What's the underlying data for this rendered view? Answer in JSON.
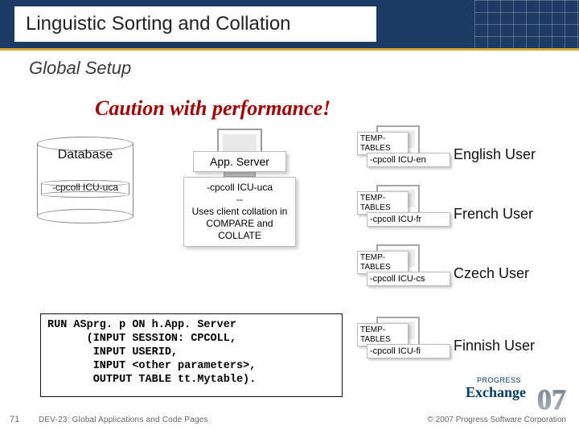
{
  "slide": {
    "number": "71",
    "title": "Linguistic Sorting and Collation",
    "subtitle": "Global Setup",
    "caution": "Caution with performance!",
    "breadcrumb": "DEV-23: Global Applications and Code Pages",
    "copyright": "© 2007 Progress Software Corporation"
  },
  "database": {
    "label": "Database",
    "param": "-cpcoll ICU-uca"
  },
  "appserver": {
    "label": "App. Server",
    "note_line1": "-cpcoll ICU-uca",
    "note_line2": "--",
    "note_rest": "Uses client collation in COMPARE and COLLATE"
  },
  "users": [
    {
      "tt": "TEMP-TABLES",
      "coll": "-cpcoll ICU-en",
      "label": "English User"
    },
    {
      "tt": "TEMP-TABLES",
      "coll": "-cpcoll ICU-fr",
      "label": "French User"
    },
    {
      "tt": "TEMP-TABLES",
      "coll": "-cpcoll ICU-cs",
      "label": "Czech User"
    },
    {
      "tt": "TEMP-TABLES",
      "coll": "-cpcoll ICU-fi",
      "label": "Finnish User"
    }
  ],
  "code": "RUN ASprg. p ON h.App. Server\n      (INPUT SESSION: CPCOLL,\n       INPUT USERID,\n       INPUT <other parameters>,\n       OUTPUT TABLE tt.Mytable).",
  "logo": {
    "brand": "PROGRESS",
    "event": "Exchange",
    "year": "07"
  }
}
